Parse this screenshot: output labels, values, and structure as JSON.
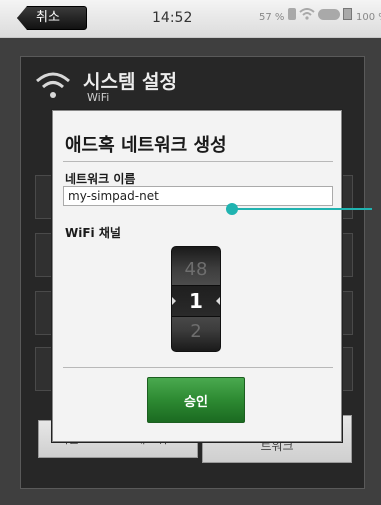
{
  "status_bar": {
    "back_label": "취소",
    "time": "14:52",
    "signal_pct": "57 %",
    "battery_pct": "100 %"
  },
  "background": {
    "title": "시스템 설정",
    "subtitle": "WiFi",
    "bottom_buttons": [
      {
        "label": "기본 SimLink 네트워크"
      },
      {
        "label": "사용자 정의 애드혹 네트워크"
      }
    ]
  },
  "dialog": {
    "title": "애드혹 네트워크 생성",
    "network_name_label": "네트워크 이름",
    "network_name_value": "my-simpad-net",
    "channel_label": "WiFi 채널",
    "channel_picker": {
      "above": "48",
      "selected": "1",
      "below": "2"
    },
    "ok_label": "승인"
  },
  "colors": {
    "callout": "#20b3b0",
    "ok_button": "#2d8a32"
  }
}
